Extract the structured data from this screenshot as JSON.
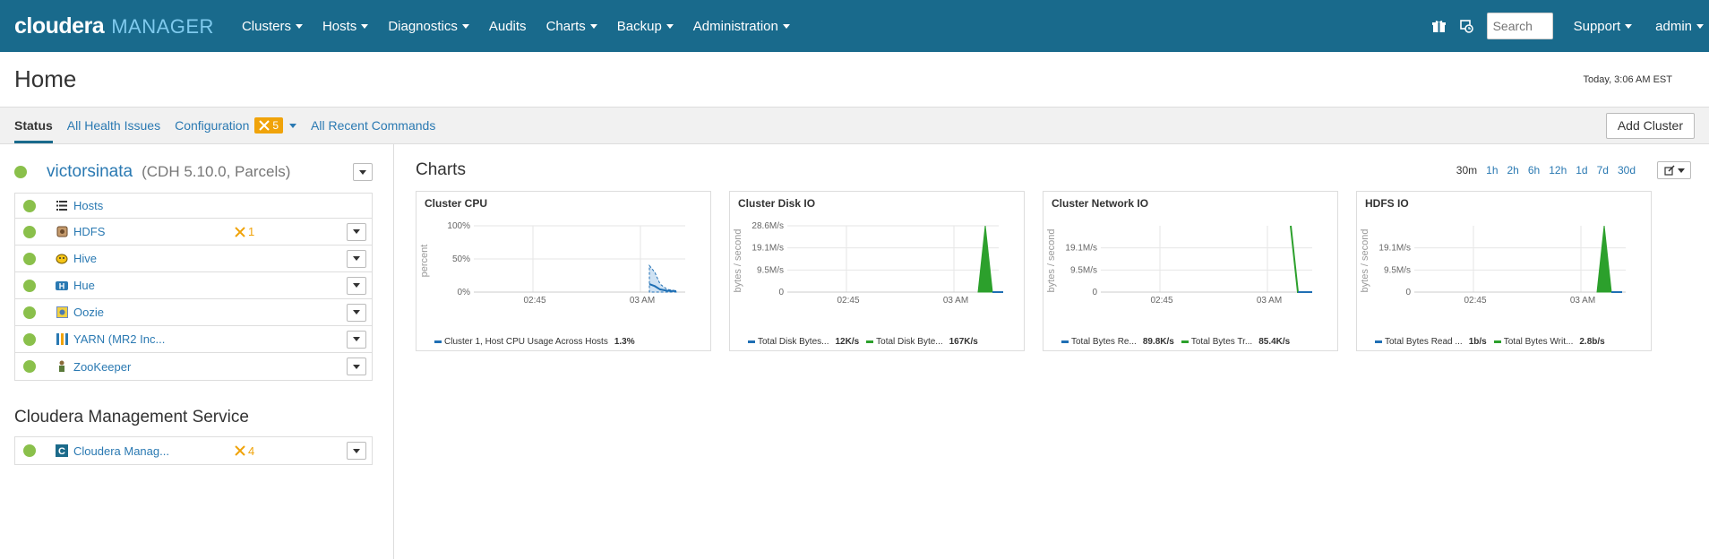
{
  "brand": {
    "cloudera": "cloudera",
    "manager": "MANAGER"
  },
  "nav": [
    "Clusters",
    "Hosts",
    "Diagnostics",
    "Audits",
    "Charts",
    "Backup",
    "Administration"
  ],
  "nav_has_caret": [
    true,
    true,
    true,
    false,
    true,
    true,
    true
  ],
  "topbar": {
    "search_placeholder": "Search",
    "support": "Support",
    "user": "admin"
  },
  "page": {
    "title": "Home",
    "time": "Today, 3:06 AM EST"
  },
  "subnav": {
    "status": "Status",
    "health": "All Health Issues",
    "configuration": "Configuration",
    "config_count": "5",
    "recent": "All Recent Commands",
    "add_cluster": "Add Cluster"
  },
  "cluster": {
    "name": "victorsinata",
    "meta": "(CDH 5.10.0, Parcels)",
    "services": [
      {
        "name": "Hosts",
        "icon": "list-icon",
        "warn": "",
        "dropdown": false
      },
      {
        "name": "HDFS",
        "icon": "hdfs-icon",
        "warn": "1",
        "dropdown": true
      },
      {
        "name": "Hive",
        "icon": "hive-icon",
        "warn": "",
        "dropdown": true
      },
      {
        "name": "Hue",
        "icon": "hue-icon",
        "warn": "",
        "dropdown": true
      },
      {
        "name": "Oozie",
        "icon": "oozie-icon",
        "warn": "",
        "dropdown": true
      },
      {
        "name": "YARN (MR2 Inc...",
        "icon": "yarn-icon",
        "warn": "",
        "dropdown": true
      },
      {
        "name": "ZooKeeper",
        "icon": "zookeeper-icon",
        "warn": "",
        "dropdown": true
      }
    ]
  },
  "mgmt": {
    "title": "Cloudera Management Service",
    "service": {
      "name": "Cloudera Manag...",
      "icon": "cloudera-icon",
      "warn": "4"
    }
  },
  "charts": {
    "title": "Charts",
    "ranges": [
      "30m",
      "1h",
      "2h",
      "6h",
      "12h",
      "1d",
      "7d",
      "30d"
    ],
    "selected_range": "30m"
  },
  "colors": {
    "topbar": "#196a8c",
    "link": "#2a79b2",
    "good": "#8ac04b",
    "warn": "#f0a30a",
    "series_blue": "#1f6fb4",
    "series_green": "#2ca02c"
  },
  "chart_data": [
    {
      "type": "area",
      "title": "Cluster CPU",
      "ylabel": "percent",
      "yticks": [
        "100%",
        "50%",
        "0%"
      ],
      "ylim": [
        0,
        100
      ],
      "xticks": [
        "02:45",
        "03 AM"
      ],
      "x": [
        "02:36",
        "02:40",
        "02:45",
        "02:50",
        "02:55",
        "03:00",
        "03:02",
        "03:03",
        "03:04",
        "03:05",
        "03:06"
      ],
      "series": [
        {
          "name": "Cluster 1, Host CPU Usage Across Hosts",
          "color": "#1f6fb4",
          "values": [
            null,
            null,
            null,
            null,
            null,
            null,
            12,
            9,
            4,
            2,
            1.3
          ],
          "band_max": [
            null,
            null,
            null,
            null,
            null,
            null,
            40,
            30,
            12,
            4,
            2
          ]
        }
      ],
      "legend": [
        {
          "label": "Cluster 1, Host CPU Usage Across Hosts",
          "value": "1.3%",
          "color": "#1f6fb4"
        }
      ]
    },
    {
      "type": "area",
      "title": "Cluster Disk IO",
      "ylabel": "bytes / second",
      "yticks": [
        "28.6M/s",
        "19.1M/s",
        "9.5M/s",
        "0"
      ],
      "ylim": [
        0,
        28.6
      ],
      "xticks": [
        "02:45",
        "03 AM"
      ],
      "series": [
        {
          "name": "Total Disk Bytes...",
          "color": "#1f6fb4"
        },
        {
          "name": "Total Disk Byte...",
          "color": "#2ca02c",
          "peak": 28.6
        }
      ],
      "legend": [
        {
          "label": "Total Disk Bytes...",
          "value": "12K/s",
          "color": "#1f6fb4"
        },
        {
          "label": "Total Disk Byte...",
          "value": "167K/s",
          "color": "#2ca02c"
        }
      ]
    },
    {
      "type": "line",
      "title": "Cluster Network IO",
      "ylabel": "bytes / second",
      "yticks": [
        "19.1M/s",
        "9.5M/s",
        "0"
      ],
      "ylim": [
        0,
        28.6
      ],
      "xticks": [
        "02:45",
        "03 AM"
      ],
      "series": [
        {
          "name": "Total Bytes Re...",
          "color": "#1f6fb4"
        },
        {
          "name": "Total Bytes Tr...",
          "color": "#2ca02c",
          "peak": 28.6
        }
      ],
      "legend": [
        {
          "label": "Total Bytes Re...",
          "value": "89.8K/s",
          "color": "#1f6fb4"
        },
        {
          "label": "Total Bytes Tr...",
          "value": "85.4K/s",
          "color": "#2ca02c"
        }
      ]
    },
    {
      "type": "area",
      "title": "HDFS IO",
      "ylabel": "bytes / second",
      "yticks": [
        "19.1M/s",
        "9.5M/s",
        "0"
      ],
      "ylim": [
        0,
        28.6
      ],
      "xticks": [
        "02:45",
        "03 AM"
      ],
      "series": [
        {
          "name": "Total Bytes Read ...",
          "color": "#1f6fb4"
        },
        {
          "name": "Total Bytes Writ...",
          "color": "#2ca02c",
          "peak": 28.6
        }
      ],
      "legend": [
        {
          "label": "Total Bytes Read ...",
          "value": "1b/s",
          "color": "#1f6fb4"
        },
        {
          "label": "Total Bytes Writ...",
          "value": "2.8b/s",
          "color": "#2ca02c"
        }
      ]
    }
  ]
}
